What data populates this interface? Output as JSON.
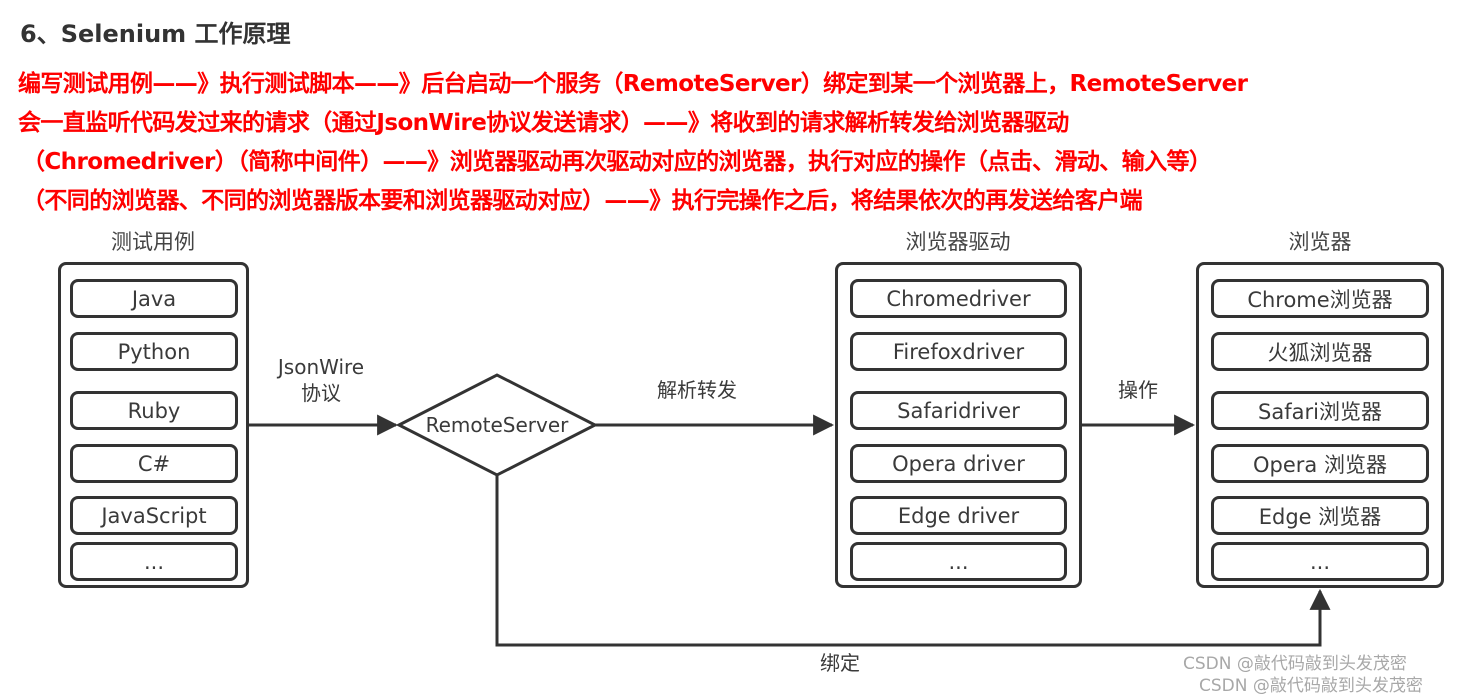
{
  "title": "6、Selenium 工作原理",
  "description_lines": [
    "编写测试用例——》执行测试脚本——》后台启动一个服务（RemoteServer）绑定到某一个浏览器上，RemoteServer",
    "会一直监听代码发过来的请求（通过JsonWire协议发送请求）——》将收到的请求解析转发给浏览器驱动",
    "（Chromedriver）（简称中间件）——》浏览器驱动再次驱动对应的浏览器，执行对应的操作（点击、滑动、输入等）",
    "（不同的浏览器、不同的浏览器版本要和浏览器驱动对应）——》执行完操作之后，将结果依次的再发送给客户端"
  ],
  "colors": {
    "title": "#333333",
    "highlight_text": "#ff0000",
    "diagram_stroke": "#333333",
    "diagram_text": "#3a3a3a",
    "watermark": "#a8a8a8"
  },
  "diagram": {
    "test_cases": {
      "label": "测试用例",
      "items": [
        "Java",
        "Python",
        "Ruby",
        "C#",
        "JavaScript",
        "..."
      ]
    },
    "remote_server": {
      "label": "RemoteServer"
    },
    "drivers": {
      "label": "浏览器驱动",
      "items": [
        "Chromedriver",
        "Firefoxdriver",
        "Safaridriver",
        "Opera driver",
        "Edge driver",
        "..."
      ]
    },
    "browsers": {
      "label": "浏览器",
      "items": [
        "Chrome浏览器",
        "火狐浏览器",
        "Safari浏览器",
        "Opera 浏览器",
        "Edge 浏览器",
        "..."
      ]
    },
    "edges": {
      "protocol_line1": "JsonWire",
      "protocol_line2": "协议",
      "parse_forward": "解析转发",
      "operate": "操作",
      "bind": "绑定"
    }
  },
  "watermarks": [
    "CSDN @敲代码敲到头发茂密",
    "CSDN @敲代码敲到头发茂密"
  ]
}
